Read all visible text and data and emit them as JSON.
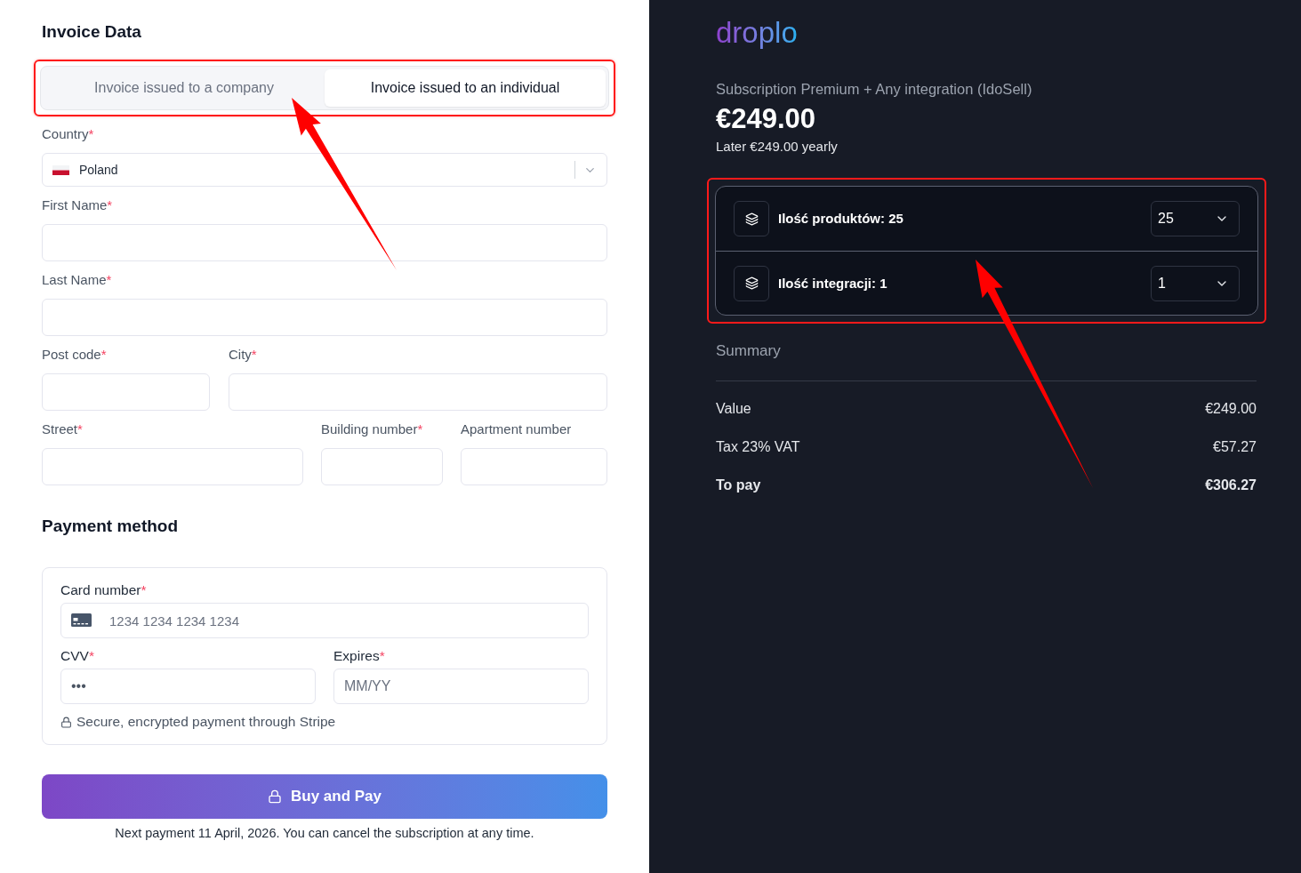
{
  "invoice": {
    "title": "Invoice Data",
    "tabs": [
      {
        "label": "Invoice issued to a company",
        "selected": false
      },
      {
        "label": "Invoice issued to an individual",
        "selected": true
      }
    ],
    "rows": [
      {
        "fields": [
          {
            "label": "Country",
            "required_mark": "*",
            "kind": "select",
            "value": "Poland"
          }
        ]
      },
      {
        "fields": [
          {
            "label": "First Name",
            "required_mark": "*",
            "kind": "text"
          }
        ]
      },
      {
        "fields": [
          {
            "label": "Last Name",
            "required_mark": "*",
            "kind": "text"
          }
        ]
      },
      {
        "fields": [
          {
            "label": "Post code",
            "required_mark": "*",
            "kind": "text"
          },
          {
            "label": "City",
            "required_mark": "*",
            "kind": "text"
          }
        ]
      },
      {
        "fields": [
          {
            "label": "Street",
            "required_mark": "*",
            "kind": "text"
          },
          {
            "label": "Building number",
            "required_mark": "*",
            "kind": "text"
          },
          {
            "label": "Apartment number",
            "kind": "text"
          }
        ]
      }
    ]
  },
  "payment": {
    "title": "Payment method",
    "card_number": {
      "label": "Card number",
      "required_mark": "*",
      "placeholder": "1234 1234 1234 1234"
    },
    "cvv": {
      "label": "CVV",
      "required_mark": "*",
      "placeholder": "•••"
    },
    "expires": {
      "label": "Expires",
      "required_mark": "*",
      "placeholder": "MM/YY"
    },
    "secure_note": "Secure, encrypted payment through Stripe",
    "pay_button": "Buy and Pay",
    "footer_note": "Next payment 11 April, 2026. You can cancel the subscription at any time."
  },
  "order": {
    "logo": "droplo",
    "plan": "Subscription Premium + Any integration (IdoSell)",
    "price": "€249.00",
    "renewal": "Later €249.00 yearly",
    "options": [
      {
        "label": "Ilość produktów: 25",
        "value": "25"
      },
      {
        "label": "Ilość integracji: 1",
        "value": "1"
      }
    ],
    "summary": {
      "title": "Summary",
      "rows": [
        {
          "label": "Value",
          "amount": "€249.00",
          "kind": "line"
        },
        {
          "label": "Tax 23% VAT",
          "amount": "€57.27",
          "kind": "line"
        },
        {
          "label": "To pay",
          "amount": "€306.27",
          "kind": "total"
        }
      ]
    }
  }
}
